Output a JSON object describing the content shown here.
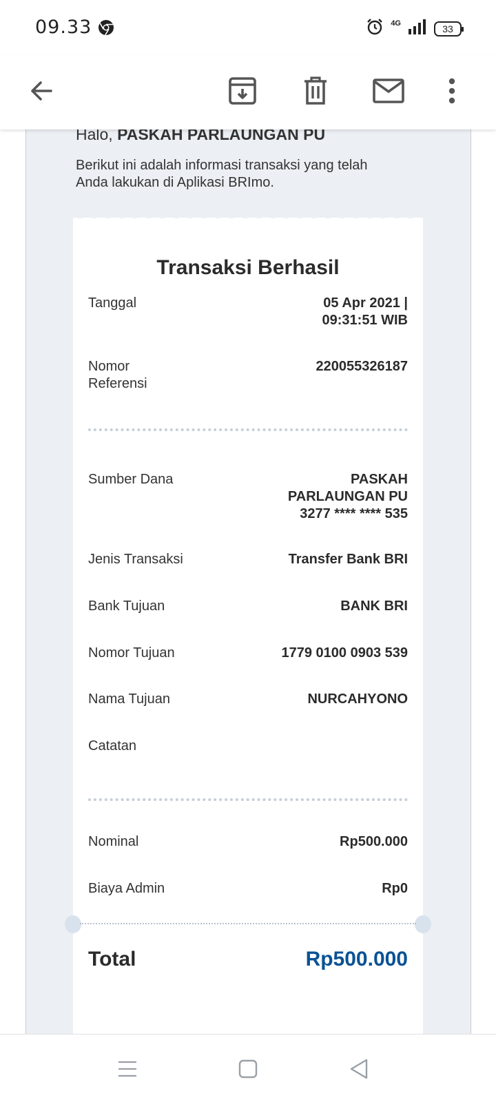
{
  "status_bar": {
    "time": "09.33",
    "network": "4G",
    "battery": "33",
    "icons": [
      "chrome-icon",
      "alarm-icon",
      "signal-icon",
      "battery-icon"
    ]
  },
  "toolbar": {
    "icons": [
      "back-arrow-icon",
      "archive-icon",
      "delete-icon",
      "mail-icon",
      "more-vert-icon"
    ]
  },
  "email": {
    "greeting_prefix": "Halo, ",
    "greeting_name": "PASKAH PARLAUNGAN PU",
    "intro": "Berikut ini adalah informasi transaksi yang telah Anda lakukan di Aplikasi BRImo."
  },
  "receipt": {
    "title": "Transaksi Berhasil",
    "tanggal_label": "Tanggal",
    "tanggal_value": "05 Apr 2021 |\n09:31:51 WIB",
    "referensi_label": "Nomor\nReferensi",
    "referensi_value": "220055326187",
    "sumber_label": "Sumber Dana",
    "sumber_value": "PASKAH\nPARLAUNGAN PU\n3277 **** **** 535",
    "jenis_label": "Jenis Transaksi",
    "jenis_value": "Transfer Bank BRI",
    "bank_label": "Bank Tujuan",
    "bank_value": "BANK BRI",
    "nomor_tujuan_label": "Nomor Tujuan",
    "nomor_tujuan_value": "1779 0100 0903 539",
    "nama_tujuan_label": "Nama Tujuan",
    "nama_tujuan_value": "NURCAHYONO",
    "catatan_label": "Catatan",
    "catatan_value": "",
    "nominal_label": "Nominal",
    "nominal_value": "Rp500.000",
    "biaya_label": "Biaya Admin",
    "biaya_value": "Rp0",
    "total_label": "Total",
    "total_value": "Rp500.000"
  },
  "colors": {
    "total_accent": "#0a5294",
    "email_background": "#eceff3"
  },
  "nav_bar": {
    "icons": [
      "menu-icon",
      "home-square-icon",
      "back-triangle-icon"
    ]
  }
}
